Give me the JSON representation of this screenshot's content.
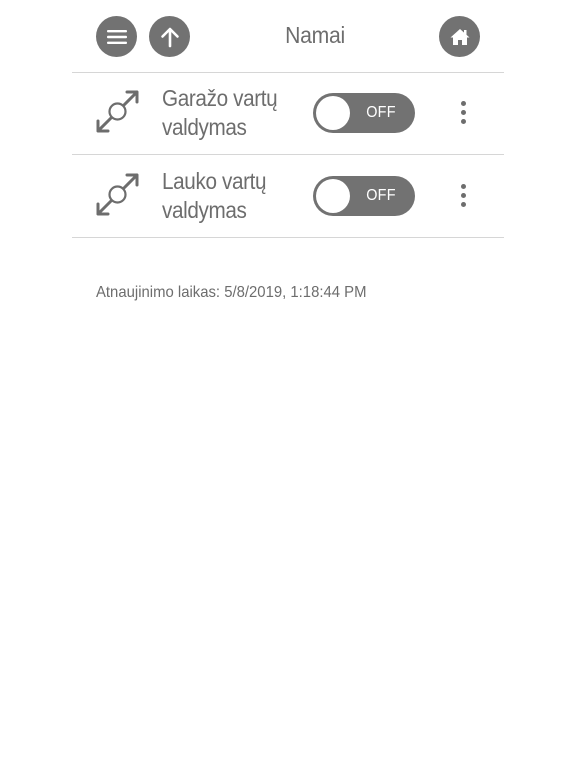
{
  "header": {
    "title": "Namai",
    "menu_icon": "menu-icon",
    "up_icon": "arrow-up-icon",
    "home_icon": "home-icon"
  },
  "devices": [
    {
      "label_line1": "Garažo vartų",
      "label_line2": "valdymas",
      "state": "OFF",
      "icon": "gate-expand-icon"
    },
    {
      "label_line1": "Lauko vartų",
      "label_line2": "valdymas",
      "state": "OFF",
      "icon": "gate-expand-icon"
    }
  ],
  "footer": {
    "update_label": "Atnaujinimo laikas:",
    "update_time": "5/8/2019, 1:18:44 PM"
  },
  "colors": {
    "accent_gray": "#727272",
    "text_gray": "#6d6d6d",
    "divider": "#d6d6d6",
    "background": "#ffffff"
  }
}
